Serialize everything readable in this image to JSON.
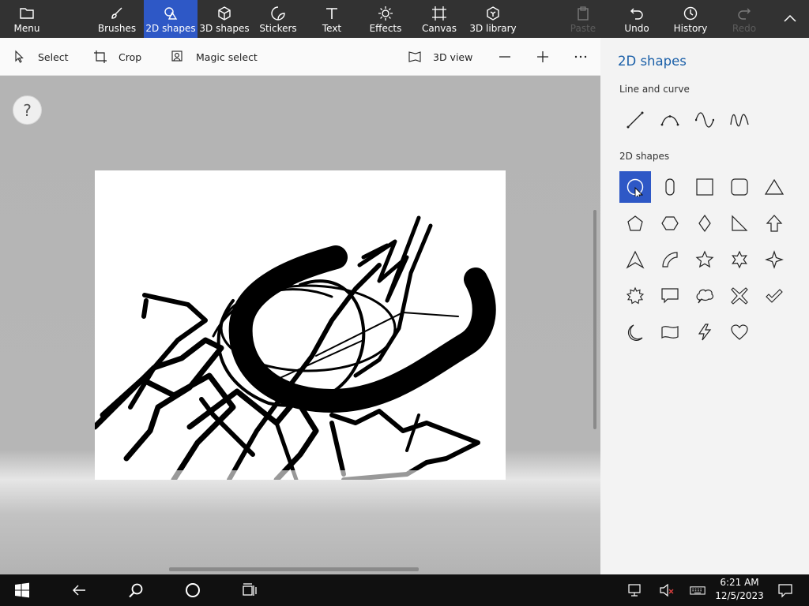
{
  "ribbon": {
    "menu_label": "Menu",
    "tabs": [
      {
        "label": "Brushes",
        "icon": "brush-icon"
      },
      {
        "label": "2D shapes",
        "icon": "2d-shapes-icon",
        "active": true
      },
      {
        "label": "3D shapes",
        "icon": "cube-icon"
      },
      {
        "label": "Stickers",
        "icon": "sticker-icon"
      },
      {
        "label": "Text",
        "icon": "text-icon"
      },
      {
        "label": "Effects",
        "icon": "sun-icon"
      },
      {
        "label": "Canvas",
        "icon": "canvas-icon"
      },
      {
        "label": "3D library",
        "icon": "3d-library-icon"
      }
    ],
    "actions": {
      "paste": "Paste",
      "undo": "Undo",
      "history": "History",
      "redo": "Redo"
    }
  },
  "toolbar": {
    "select": "Select",
    "crop": "Crop",
    "magic_select": "Magic select",
    "view_3d": "3D view"
  },
  "workspace": {
    "help_label": "?"
  },
  "panel": {
    "title": "2D shapes",
    "line_section": "Line and curve",
    "shapes_section": "2D shapes",
    "lines": [
      "line-icon",
      "curve-icon",
      "s-curve-icon",
      "wave-curve-icon"
    ],
    "shapes": [
      "circle-icon",
      "rounded-rect-vertical-icon",
      "square-icon",
      "rounded-square-icon",
      "triangle-icon",
      "pentagon-icon",
      "hexagon-icon",
      "diamond-icon",
      "right-triangle-icon",
      "arrow-up-icon",
      "arrowhead-icon",
      "quarter-circle-icon",
      "star-5-icon",
      "star-6-icon",
      "star-4-icon",
      "burst-icon",
      "speech-bubble-icon",
      "thought-bubble-icon",
      "x-mark-icon",
      "check-mark-icon",
      "moon-icon",
      "banner-icon",
      "lightning-icon",
      "heart-icon"
    ],
    "selected_shape": "circle-icon"
  },
  "taskbar": {
    "time": "6:21 AM",
    "date": "12/5/2023"
  },
  "colors": {
    "accent": "#2e58c6",
    "ribbon_bg": "#323232",
    "panel_title": "#1a5fa8",
    "taskbar_bg": "#101010"
  }
}
